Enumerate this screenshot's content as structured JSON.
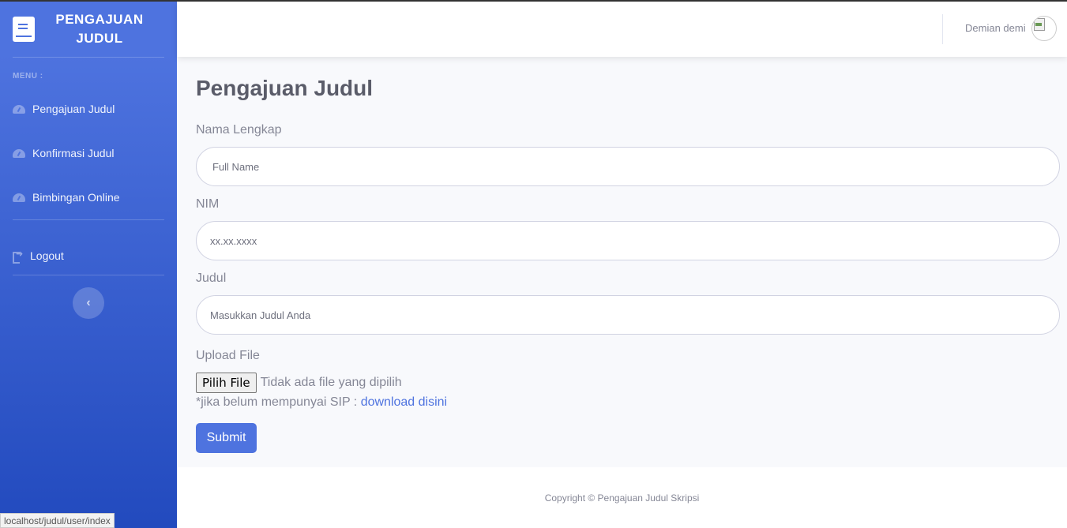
{
  "sidebar": {
    "brand_title": "PENGAJUAN JUDUL",
    "menu_heading": "MENU :",
    "items": [
      {
        "label": "Pengajuan Judul",
        "icon": "tachometer-icon"
      },
      {
        "label": "Konfirmasi Judul",
        "icon": "tachometer-icon"
      },
      {
        "label": "Bimbingan Online",
        "icon": "tachometer-icon"
      }
    ],
    "logout_label": "Logout",
    "toggle_icon": "‹"
  },
  "topbar": {
    "user_name": "Demian demi"
  },
  "main": {
    "title": "Pengajuan Judul",
    "fields": {
      "name_label": "Nama Lengkap",
      "name_placeholder": "Full Name",
      "nim_label": "NIM",
      "nim_placeholder": "xx.xx.xxxx",
      "judul_label": "Judul",
      "judul_placeholder": "Masukkan Judul Anda",
      "upload_label": "Upload File",
      "file_button": "Pilih File",
      "file_status": "Tidak ada file yang dipilih",
      "hint_text": "*jika belum mempunyai SIP : ",
      "hint_link": "download disini"
    },
    "submit_label": "Submit"
  },
  "footer": {
    "copyright": "Copyright © Pengajuan Judul Skripsi"
  },
  "statusbar": {
    "url": "localhost/judul/user/index"
  },
  "colors": {
    "primary": "#4e73df",
    "text_gray": "#858796",
    "title_gray": "#5a5c69"
  }
}
